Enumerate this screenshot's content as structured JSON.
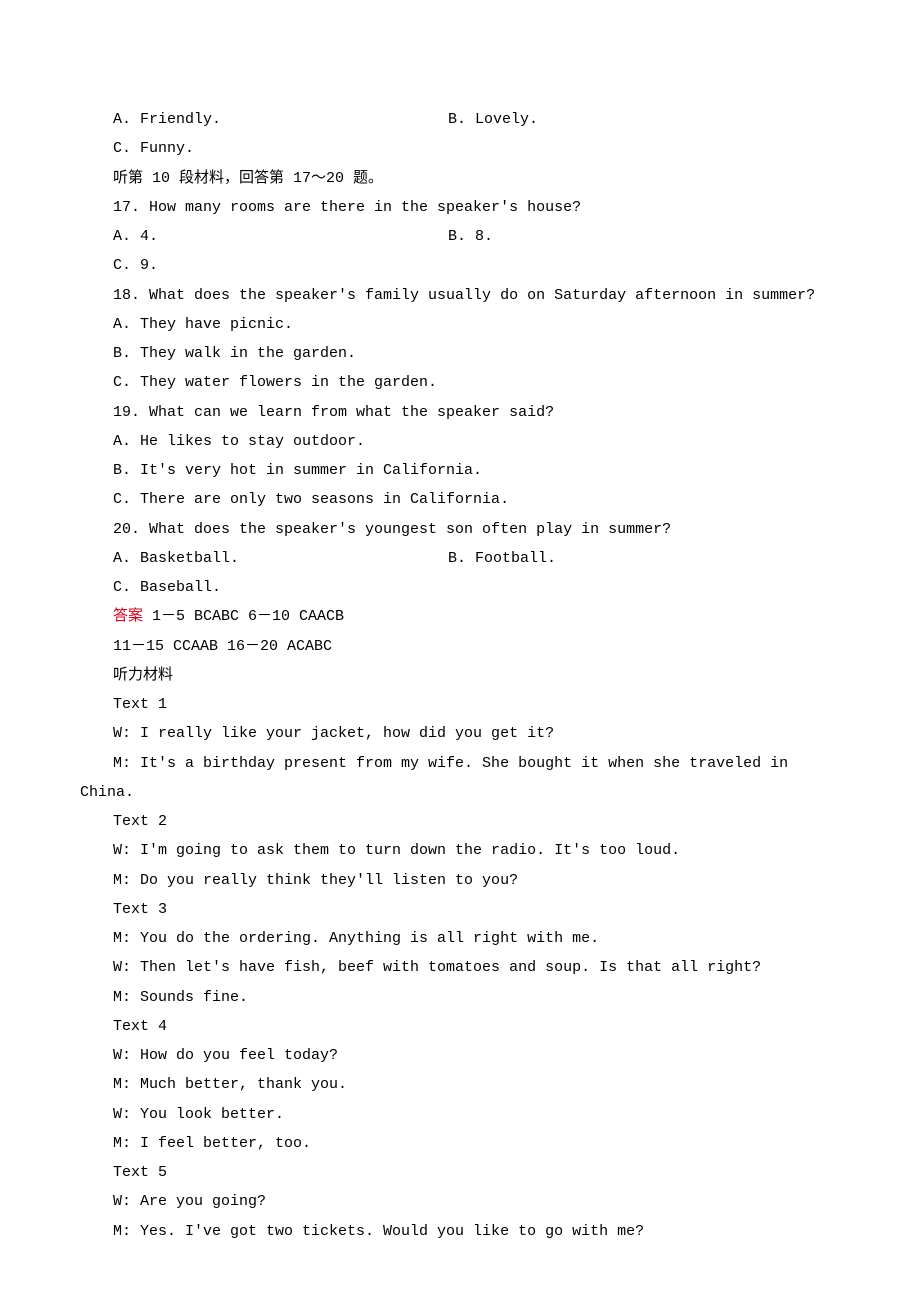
{
  "q16": {
    "A": "A. Friendly.",
    "B": "B. Lovely.",
    "C": "C. Funny."
  },
  "sec10_header": "听第 10 段材料，回答第 17～20 题。",
  "q17": {
    "stem": "17. How many rooms are there in the speaker's house?",
    "A": "A. 4.",
    "B": "B. 8.",
    "C": "C. 9."
  },
  "q18": {
    "stem": "18. What does the speaker's family usually do on Saturday afternoon in summer?",
    "A": "A. They have picnic.",
    "B": "B. They walk in the garden.",
    "C": "C. They water flowers in the garden."
  },
  "q19": {
    "stem": "19. What can we learn from what the speaker said?",
    "A": "A. He likes to stay outdoor.",
    "B": "B. It's very hot in summer in California.",
    "C": "C. There are only two seasons in California."
  },
  "q20": {
    "stem": "20. What does the speaker's youngest son often play in summer?",
    "A": "A. Basketball.",
    "B": "B. Football.",
    "C": "C. Baseball."
  },
  "answer": {
    "label": "答案",
    "line1": "  1－5  BCABC  6－10  CAACB",
    "line2": "11－15  CCAAB  16－20  ACABC"
  },
  "material_header": "听力材料",
  "texts": {
    "t1": {
      "h": "Text 1",
      "w": "W: I really like your jacket, how did you get it?",
      "m_a": "M: It's a birthday present from my wife. She bought it when she traveled in",
      "m_b": "China."
    },
    "t2": {
      "h": "Text 2",
      "w": "W: I'm going to ask them to turn down the radio. It's too loud.",
      "m": "M: Do you really think they'll listen to you?"
    },
    "t3": {
      "h": "Text 3",
      "m1": "M: You do the ordering. Anything is all right with me.",
      "w": "W: Then let's have fish, beef with tomatoes and soup. Is that all right?",
      "m2": "M: Sounds fine."
    },
    "t4": {
      "h": "Text 4",
      "w1": "W: How do you feel today?",
      "m1": "M: Much better, thank you.",
      "w2": "W: You look better.",
      "m2": "M: I feel better, too."
    },
    "t5": {
      "h": "Text 5",
      "w": "W: Are you going?",
      "m": "M: Yes. I've got two tickets. Would you like to go with me?"
    }
  }
}
